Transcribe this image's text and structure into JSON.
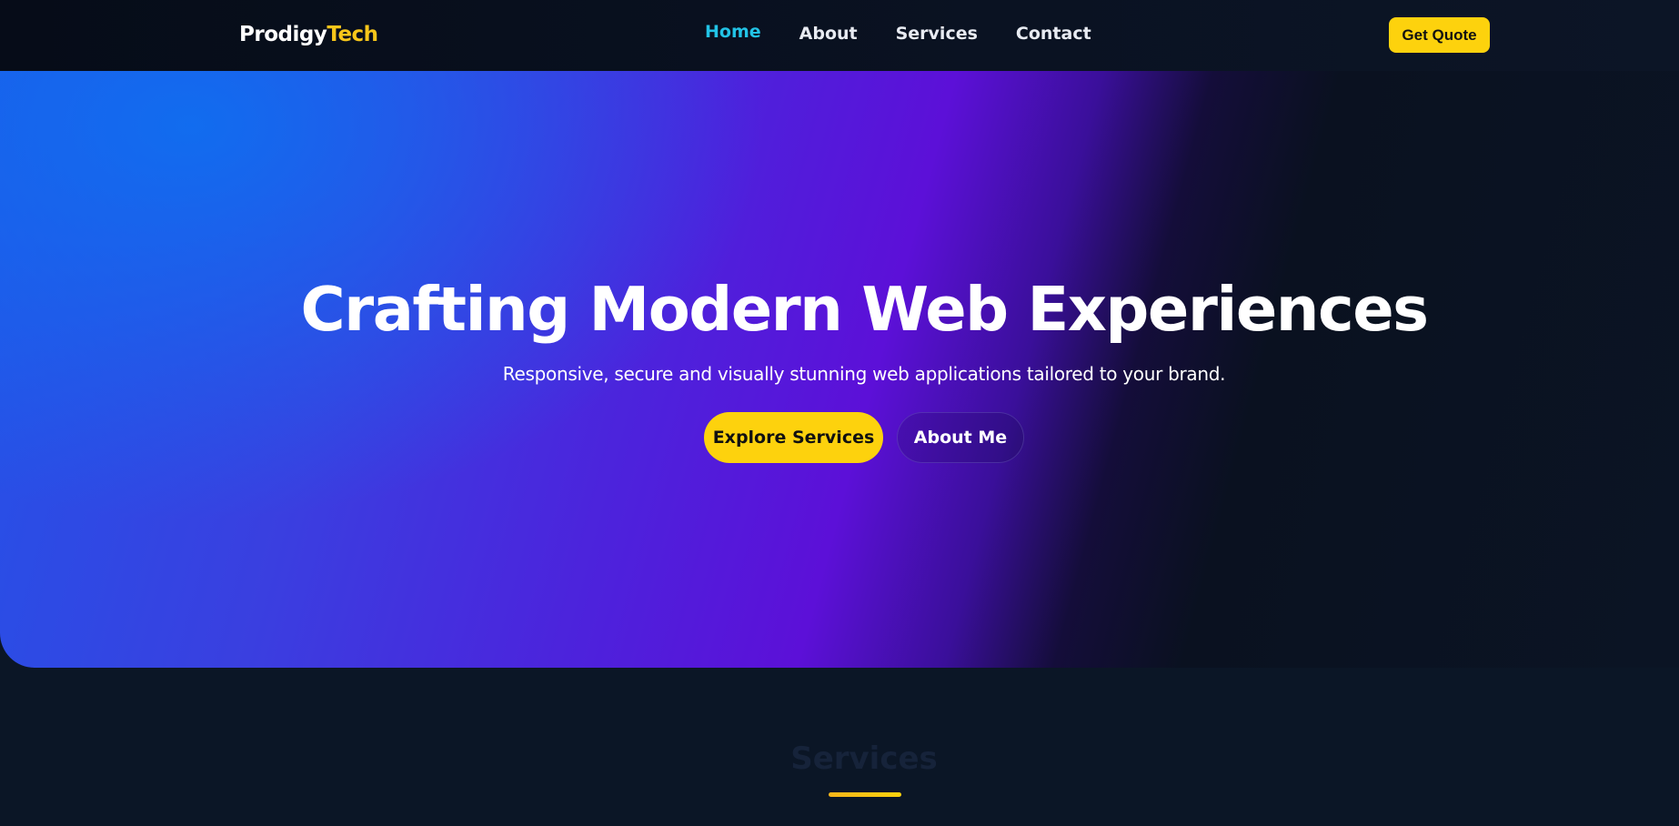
{
  "brand": {
    "name_part1": "Prodigy",
    "name_part2": "Tech",
    "accent_color": "#f7c61a"
  },
  "nav": {
    "items": [
      {
        "label": "Home",
        "active": true
      },
      {
        "label": "About",
        "active": false
      },
      {
        "label": "Services",
        "active": false
      },
      {
        "label": "Contact",
        "active": false
      }
    ],
    "active_color": "#22c3e6",
    "cta_label": "Get Quote"
  },
  "hero": {
    "title": "Crafting Modern Web Experiences",
    "subtitle": "Responsive, secure and visually stunning web applications tailored to your brand.",
    "primary_button": "Explore Services",
    "secondary_button": "About Me"
  },
  "services_section": {
    "title": "Services"
  },
  "colors": {
    "button_yellow": "#fdd20d",
    "page_background": "#0b1626"
  }
}
